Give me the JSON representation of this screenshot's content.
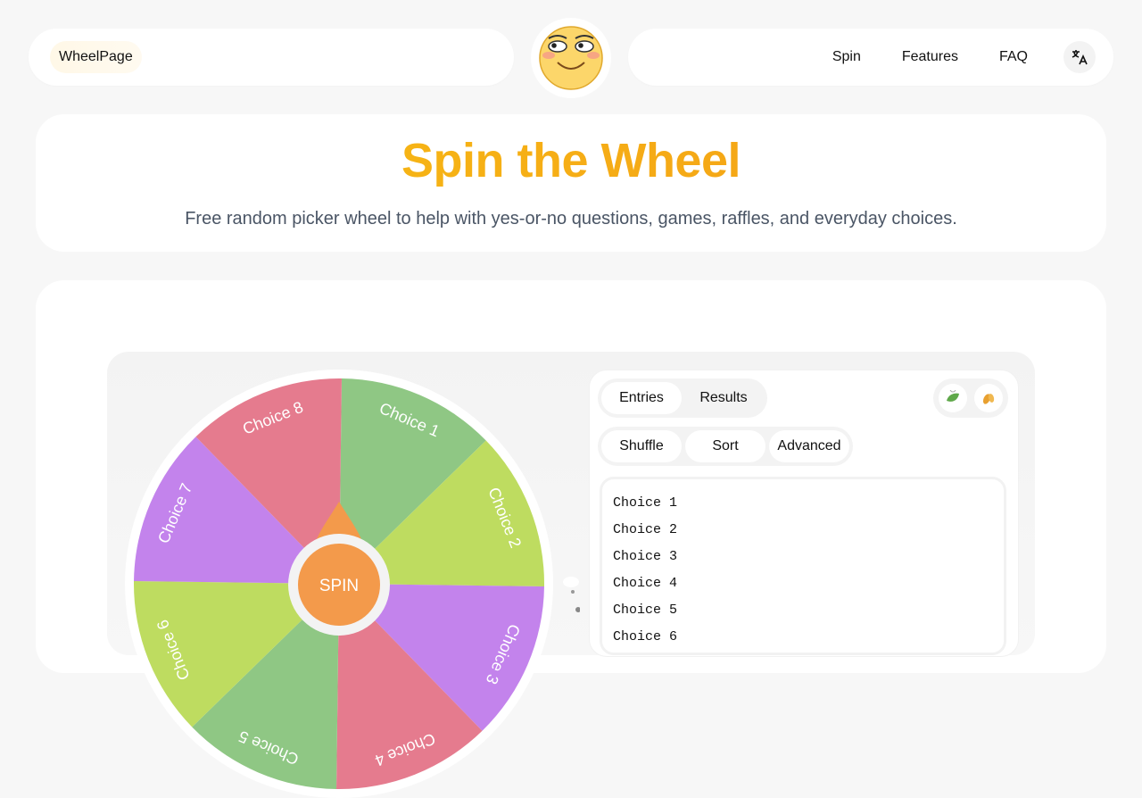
{
  "header": {
    "brand": "WheelPage",
    "nav": [
      "Spin",
      "Features",
      "FAQ"
    ],
    "lang_icon": "translate-icon"
  },
  "hero": {
    "title": "Spin the Wheel",
    "subtitle": "Free random picker wheel to help with yes-or-no questions, games, raffles, and everyday choices."
  },
  "wheel": {
    "spin_label": "SPIN",
    "segments": [
      {
        "label": "Choice 1",
        "color": "#8fc784"
      },
      {
        "label": "Choice 2",
        "color": "#bedc60"
      },
      {
        "label": "Choice 3",
        "color": "#c383ec"
      },
      {
        "label": "Choice 4",
        "color": "#e57b8e"
      },
      {
        "label": "Choice 5",
        "color": "#8fc784"
      },
      {
        "label": "Choice 6",
        "color": "#bedc60"
      },
      {
        "label": "Choice 7",
        "color": "#c383ec"
      },
      {
        "label": "Choice 8",
        "color": "#e57b8e"
      }
    ],
    "hub_color": "#f39a4b"
  },
  "panel": {
    "tabs": [
      "Entries",
      "Results"
    ],
    "active_tab": "Entries",
    "actions": [
      "Shuffle",
      "Sort",
      "Advanced"
    ],
    "entries": [
      "Choice 1",
      "Choice 2",
      "Choice 3",
      "Choice 4",
      "Choice 5",
      "Choice 6"
    ],
    "icons": [
      "leaf-icon",
      "seeds-icon"
    ]
  }
}
